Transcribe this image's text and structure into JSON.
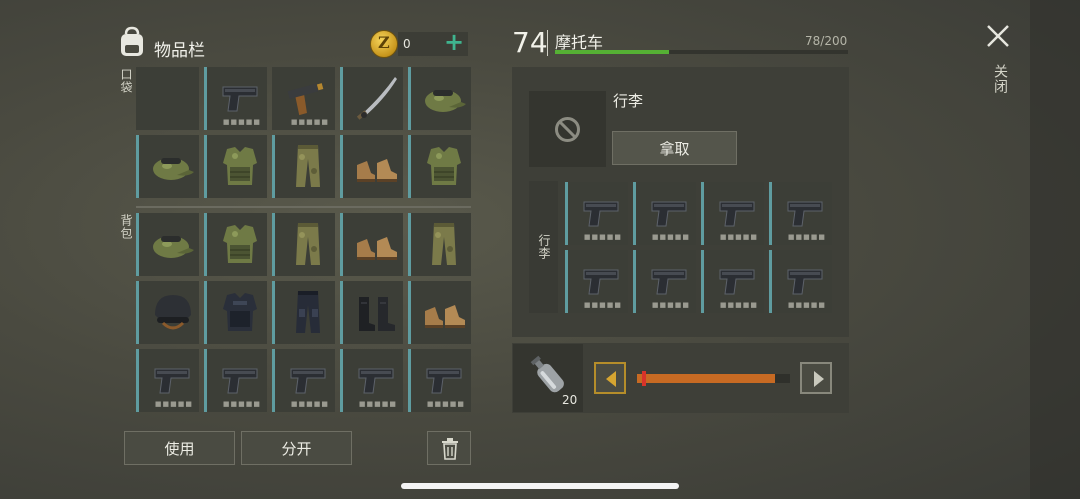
{
  "inventory": {
    "title": "物品栏",
    "currency_value": "0",
    "currency_symbol": "Z",
    "add_label": "+",
    "pockets_label": "口袋",
    "backpack_label": "背包",
    "pockets": [
      {
        "icon": "empty",
        "accent": false,
        "durability": false
      },
      {
        "icon": "pistol-icon",
        "accent": true,
        "durability": true
      },
      {
        "icon": "flare-gun-icon",
        "accent": false,
        "durability": true
      },
      {
        "icon": "katana-icon",
        "accent": true,
        "durability": false
      },
      {
        "icon": "camo-cap-icon",
        "accent": true,
        "durability": false
      },
      {
        "icon": "camo-cap-icon",
        "accent": true,
        "durability": false
      },
      {
        "icon": "camo-vest-icon",
        "accent": true,
        "durability": false
      },
      {
        "icon": "camo-pants-icon",
        "accent": true,
        "durability": false
      },
      {
        "icon": "boots-icon",
        "accent": true,
        "durability": false
      },
      {
        "icon": "camo-vest-icon",
        "accent": true,
        "durability": false
      }
    ],
    "backpack": [
      {
        "icon": "camo-cap-icon",
        "accent": true,
        "durability": false
      },
      {
        "icon": "camo-vest-icon",
        "accent": true,
        "durability": false
      },
      {
        "icon": "camo-pants-icon",
        "accent": true,
        "durability": false
      },
      {
        "icon": "boots-icon",
        "accent": true,
        "durability": false
      },
      {
        "icon": "camo-pants-icon",
        "accent": true,
        "durability": false
      },
      {
        "icon": "helmet-icon",
        "accent": true,
        "durability": false
      },
      {
        "icon": "police-vest-icon",
        "accent": true,
        "durability": false
      },
      {
        "icon": "police-pants-icon",
        "accent": true,
        "durability": false
      },
      {
        "icon": "black-boots-icon",
        "accent": true,
        "durability": false
      },
      {
        "icon": "boots-icon",
        "accent": true,
        "durability": false
      },
      {
        "icon": "pistol-icon",
        "accent": true,
        "durability": true
      },
      {
        "icon": "pistol-icon",
        "accent": true,
        "durability": true
      },
      {
        "icon": "pistol-icon",
        "accent": true,
        "durability": true
      },
      {
        "icon": "pistol-icon",
        "accent": true,
        "durability": true
      },
      {
        "icon": "pistol-icon",
        "accent": true,
        "durability": true
      }
    ],
    "use_label": "使用",
    "split_label": "分开"
  },
  "vehicle": {
    "level": "74",
    "name": "摩托车",
    "capacity": "78/200",
    "capacity_fraction": 0.39,
    "luggage_title": "行李",
    "take_label": "拿取",
    "luggage_side_label": "行李",
    "luggage": [
      {
        "icon": "pistol-icon",
        "accent": true,
        "durability": true
      },
      {
        "icon": "pistol-icon",
        "accent": true,
        "durability": true
      },
      {
        "icon": "pistol-icon",
        "accent": true,
        "durability": true
      },
      {
        "icon": "pistol-icon",
        "accent": true,
        "durability": true
      },
      {
        "icon": "pistol-icon",
        "accent": true,
        "durability": true
      },
      {
        "icon": "pistol-icon",
        "accent": true,
        "durability": true
      },
      {
        "icon": "pistol-icon",
        "accent": true,
        "durability": true
      },
      {
        "icon": "pistol-icon",
        "accent": true,
        "durability": true
      }
    ]
  },
  "fuel": {
    "item_icon": "gas-bottle-icon",
    "count": "20",
    "amount_fraction": 0.9
  },
  "close_label": "关闭",
  "colors": {
    "accent_bar": "#5f9ca0",
    "capacity_fill": "#55b034",
    "slider_fill": "#c76a23",
    "add_green": "#3fb48f"
  }
}
